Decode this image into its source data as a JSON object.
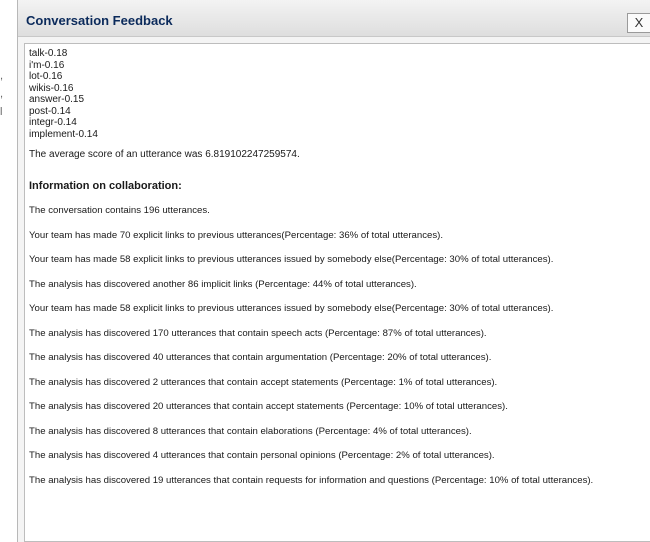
{
  "window": {
    "title": "Conversation Feedback",
    "close_label": "X"
  },
  "keywords": [
    "talk-0.18",
    "i'm-0.16",
    "lot-0.16",
    "wikis-0.16",
    "answer-0.15",
    "post-0.14",
    "integr-0.14",
    "implement-0.14"
  ],
  "average_text": "The average score of an utterance was 6.819102247259574.",
  "collab_heading": "Information on collaboration:",
  "messages": [
    "The conversation contains 196 utterances.",
    "Your team has made 70 explicit links to previous utterances(Percentage: 36% of total utterances).",
    "Your team has made 58 explicit links to previous utterances issued by somebody else(Percentage: 30% of total utterances).",
    "The analysis has discovered another 86 implicit links (Percentage: 44% of total utterances).",
    "Your team has made 58 explicit links to previous utterances issued by somebody else(Percentage: 30% of total utterances).",
    "The analysis has discovered 170 utterances that contain speech acts (Percentage: 87% of total utterances).",
    "The analysis has discovered 40 utterances that contain argumentation (Percentage: 20% of total utterances).",
    "The analysis has discovered 2 utterances that contain accept statements (Percentage: 1% of total utterances).",
    "The analysis has discovered 20 utterances that contain accept statements (Percentage: 10% of total utterances).",
    "The analysis has discovered 8 utterances that contain elaborations (Percentage: 4% of total utterances).",
    "The analysis has discovered 4 utterances that contain personal opinions (Percentage: 2% of total utterances).",
    "The analysis has discovered 19 utterances that contain requests for information and questions (Percentage: 10% of total utterances)."
  ]
}
